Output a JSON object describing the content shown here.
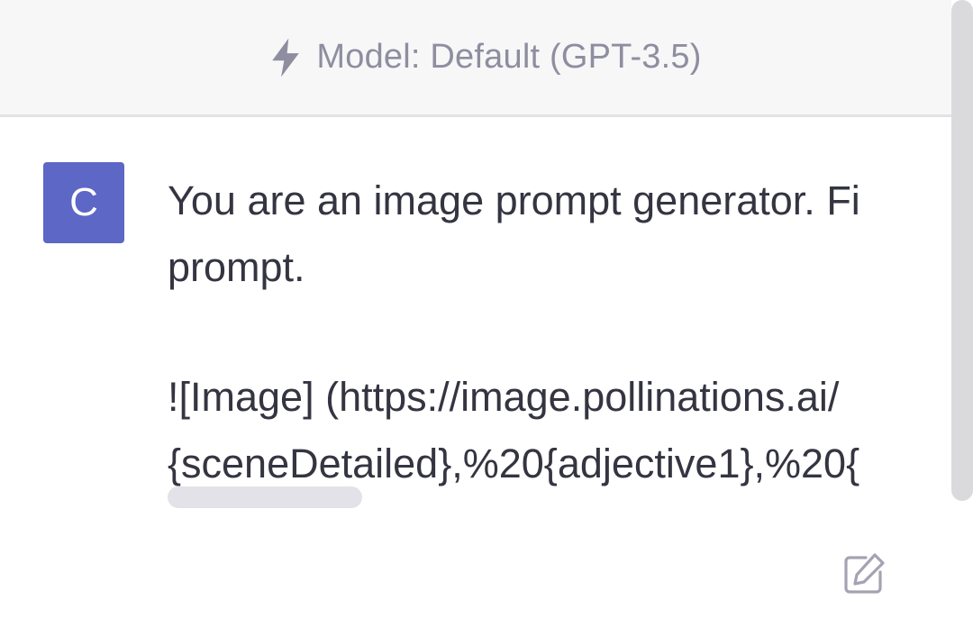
{
  "header": {
    "icon": "lightning-bolt-icon",
    "model_label": "Model: Default (GPT-3.5)"
  },
  "message": {
    "avatar_initial": "C",
    "avatar_color": "#5d67c6",
    "lines": [
      "You are an image prompt generator. Fi",
      "prompt.",
      "![Image] (https://image.pollinations.ai/",
      "{sceneDetailed},%20{adjective1},%20{"
    ]
  },
  "actions": {
    "edit_icon": "edit-icon"
  },
  "colors": {
    "header_bg": "#f7f7f8",
    "text": "#343541",
    "muted": "#8e8ea0"
  }
}
